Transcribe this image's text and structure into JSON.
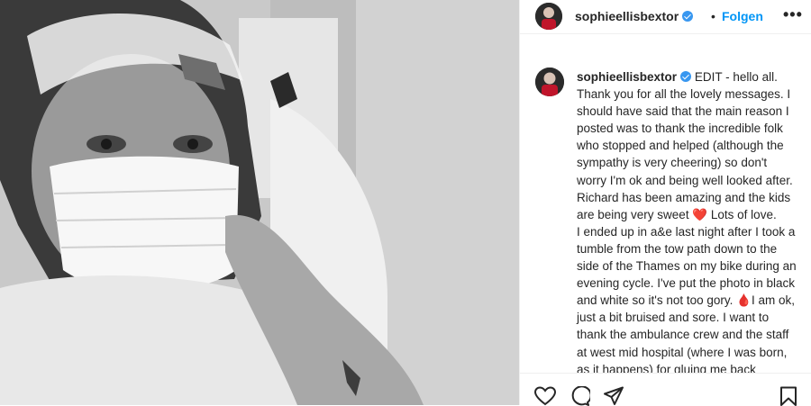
{
  "post": {
    "username": "sophieellisbextor",
    "separator": "•",
    "follow_label": "Folgen",
    "more_label": "•••",
    "caption": {
      "username": "sophieellisbextor",
      "part1": "EDIT - hello all. Thank you for all the lovely messages. I should have said that the main reason I posted was to thank the incredible folk who stopped and helped (although the sympathy is very cheering) so don't worry I'm ok and being well looked after. Richard has been amazing and the kids are being very sweet",
      "heart_emoji": "❤️",
      "part2": " Lots of love.",
      "part3": "I ended up in a&e last night after I took a tumble from the tow path down to the side of the Thames on my bike during an evening cycle. I've put the photo in black and white so it's not too gory.",
      "drop_emoji": "🩸",
      "part4": "I am ok, just a bit bruised and sore. I want to thank the ambulance crew and the staff at west mid hospital (where I was born, as it happens) for gluing me back together."
    }
  },
  "icons": [
    "heart-icon",
    "comment-icon",
    "share-icon",
    "bookmark-icon",
    "verified-badge-icon"
  ],
  "colors": {
    "link_blue": "#0095f6",
    "verified_blue": "#3897f0",
    "text": "#262626",
    "border": "#efefef"
  }
}
